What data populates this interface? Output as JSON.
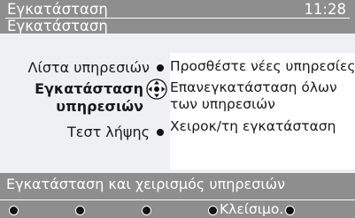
{
  "header": {
    "title": "Εγκατάσταση",
    "clock": "11:28",
    "subtitle": "Εγκατάσταση"
  },
  "menu": {
    "items": [
      {
        "label": "Λίστα υπηρεσιών",
        "selected": false
      },
      {
        "label_line1": "Εγκατάσταση",
        "label_line2": "υπηρεσιών",
        "selected": true
      },
      {
        "label": "Τεστ λήψης",
        "selected": false
      }
    ]
  },
  "options": {
    "items": [
      {
        "label": "Προσθέστε νέες υπηρεσίες."
      },
      {
        "label_line1": "Επανεγκατάσταση όλων",
        "label_line2": "των υπηρεσιών"
      },
      {
        "label": "Χειροκ/τη εγκατάσταση"
      }
    ]
  },
  "status": {
    "text": "Εγκατάσταση και χειρισμός υπηρεσιών"
  },
  "controls": {
    "close_label": "Κλείσιμο."
  },
  "colors": {
    "bar": "#8e8e8e",
    "panel_left": "#eef0f4",
    "panel_right": "#ffffff",
    "text_light": "#ffffff",
    "text_dark": "#1a1a1a"
  }
}
